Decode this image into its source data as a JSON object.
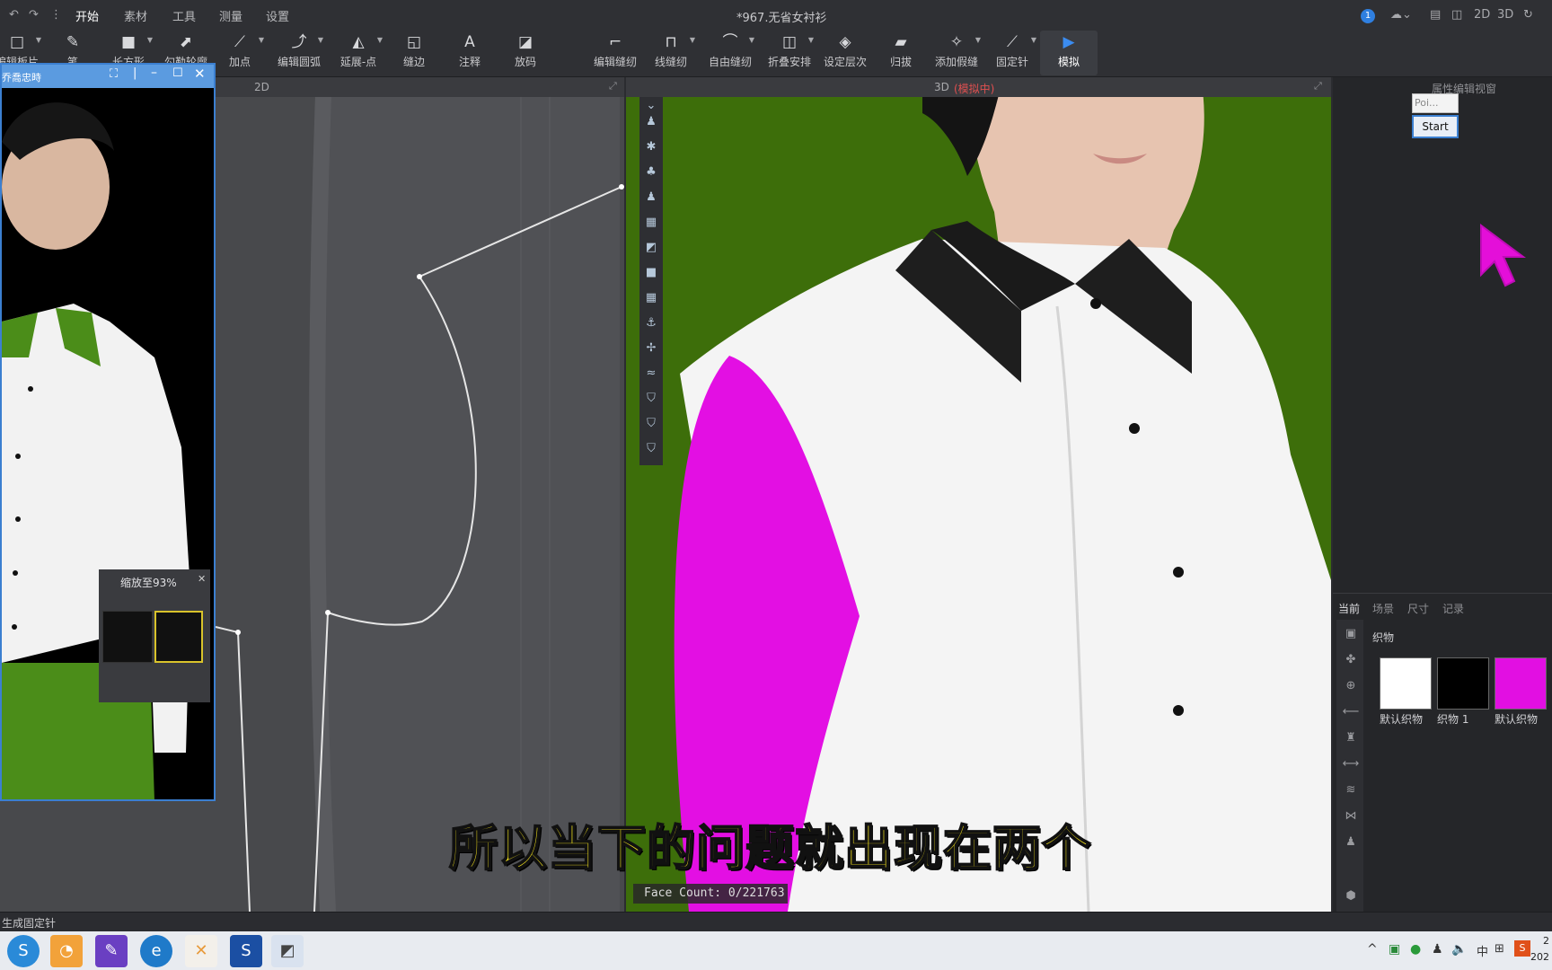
{
  "titlebar": {
    "undo_icon": "undo-icon",
    "redo_icon": "redo-icon",
    "more": "⋮",
    "menus": [
      "开始",
      "素材",
      "工具",
      "测量",
      "设置"
    ],
    "doc_title": "*967.无省女衬衫",
    "notif_count": "1",
    "view_2d": "2D",
    "view_3d": "3D"
  },
  "toolbar": {
    "tools_left": [
      {
        "label": "编辑板片",
        "icon": "□"
      },
      {
        "label": "笔",
        "icon": "✎"
      },
      {
        "label": "长方形",
        "icon": "■"
      },
      {
        "label": "勾勒轮廓",
        "icon": "⬈"
      },
      {
        "label": "加点",
        "icon": "⟋"
      },
      {
        "label": "编辑圆弧",
        "icon": "⤴"
      },
      {
        "label": "延展-点",
        "icon": "◭"
      },
      {
        "label": "缝边",
        "icon": "◱"
      },
      {
        "label": "注释",
        "icon": "A"
      },
      {
        "label": "放码",
        "icon": "◪"
      }
    ],
    "tools_right": [
      {
        "label": "编辑缝纫",
        "icon": "⌐"
      },
      {
        "label": "线缝纫",
        "icon": "⊓"
      },
      {
        "label": "自由缝纫",
        "icon": "⌒"
      },
      {
        "label": "折叠安排",
        "icon": "◫"
      },
      {
        "label": "设定层次",
        "icon": "◈"
      },
      {
        "label": "归拔",
        "icon": "▰"
      },
      {
        "label": "添加假缝",
        "icon": "✧"
      },
      {
        "label": "固定针",
        "icon": "⟋"
      },
      {
        "label": "模拟",
        "icon": "▶"
      }
    ]
  },
  "view2d": {
    "label": "2D"
  },
  "view3d": {
    "label": "3D",
    "status": "(模拟中)",
    "face_count": "Face Count: 0/221763"
  },
  "floatwin": {
    "title": "乔喬忠時"
  },
  "zoom_popup": {
    "text": "缩放至93%"
  },
  "right_panel": {
    "title": "属性编辑视窗",
    "poi_label": "Poi...",
    "start_button": "Start",
    "tabs": [
      "当前",
      "场景",
      "尺寸",
      "记录"
    ],
    "section": "织物",
    "swatches": [
      {
        "label": "默认织物",
        "color": "#ffffff"
      },
      {
        "label": "织物 1",
        "color": "#000000"
      },
      {
        "label": "默认织物",
        "color": "#e20fe2"
      }
    ]
  },
  "status_bar": {
    "text": "生成固定针"
  },
  "subtitle": "所以当下的问题就出现在两个",
  "taskbar": {
    "apps": [
      "sogou-icon",
      "wechat-icon",
      "paint-icon",
      "browser-icon",
      "app-icon",
      "s-app-icon",
      "clo-icon"
    ],
    "tray_text": "中",
    "time": "2",
    "date": "202"
  }
}
